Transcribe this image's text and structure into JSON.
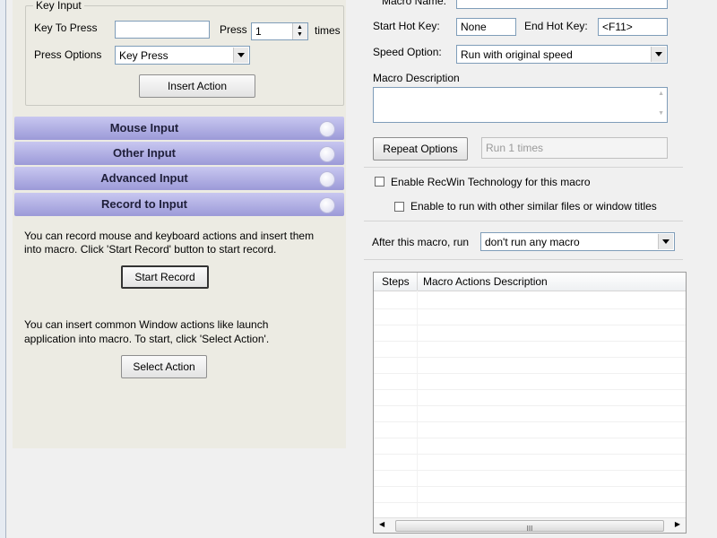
{
  "key_input": {
    "group_title": "Key Input",
    "key_to_press_label": "Key To Press",
    "key_to_press_value": "",
    "press_label": "Press",
    "press_value": "1",
    "times_label": "times",
    "press_options_label": "Press Options",
    "press_options_value": "Key Press",
    "insert_action_label": "Insert Action"
  },
  "sections": [
    {
      "label": "Mouse Input"
    },
    {
      "label": "Other Input"
    },
    {
      "label": "Advanced Input"
    },
    {
      "label": "Record to Input"
    }
  ],
  "record": {
    "line1": "You can record mouse and keyboard actions and insert them",
    "line2": "into macro. Click 'Start Record' button to start record.",
    "start_record_label": "Start Record",
    "window_line1": "You can insert common Window actions like launch",
    "window_line2": "application into macro. To start, click 'Select Action'.",
    "select_action_label": "Select Action"
  },
  "macro": {
    "name_label": "Macro Name:",
    "start_hotkey_label": "Start Hot Key:",
    "start_hotkey_value": "None",
    "end_hotkey_label": "End Hot Key:",
    "end_hotkey_value": "<F11>",
    "speed_label": "Speed Option:",
    "speed_value": "Run with original speed",
    "description_label": "Macro Description",
    "description_value": "",
    "repeat_options_label": "Repeat Options",
    "repeat_value": "Run 1 times",
    "recwin_label": "Enable RecWin Technology for this macro",
    "similar_label": "Enable to run with other similar files or window titles",
    "after_label": "After this macro, run",
    "after_value": "don't run any macro"
  },
  "table": {
    "columns": [
      "Steps",
      "Macro Actions Description"
    ],
    "scroll_grip": "III"
  }
}
